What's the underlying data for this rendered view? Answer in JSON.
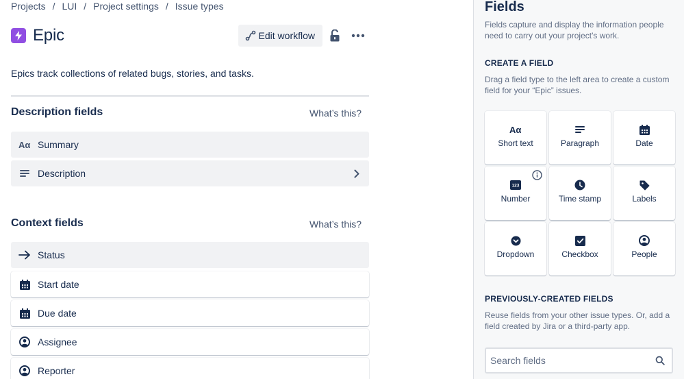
{
  "breadcrumb": [
    "Projects",
    "LUI",
    "Project settings",
    "Issue types"
  ],
  "breadcrumb_separator": "/",
  "issue_type": {
    "title": "Epic",
    "icon": "lightning-icon",
    "color": "#904ee2",
    "description": "Epics track collections of related bugs, stories, and tasks."
  },
  "actions": {
    "edit_workflow_label": "Edit workflow",
    "lock_icon": "unlock-icon",
    "more_icon": "more-icon"
  },
  "description_fields": {
    "title": "Description fields",
    "help": "What’s this?",
    "items": [
      {
        "label": "Summary",
        "icon": "short-text-icon"
      },
      {
        "label": "Description",
        "icon": "paragraph-icon"
      }
    ]
  },
  "context_fields": {
    "title": "Context fields",
    "help": "What’s this?",
    "items": [
      {
        "label": "Status",
        "icon": "arrow-right-icon"
      },
      {
        "label": "Start date",
        "icon": "calendar-icon"
      },
      {
        "label": "Due date",
        "icon": "calendar-icon"
      },
      {
        "label": "Assignee",
        "icon": "person-icon"
      },
      {
        "label": "Reporter",
        "icon": "person-icon"
      }
    ]
  },
  "panel": {
    "title": "Fields",
    "description": "Fields capture and display the information people need to carry out your project's work.",
    "create": {
      "heading": "CREATE A FIELD",
      "description": "Drag a field type to the left area to create a custom field for your “Epic” issues.",
      "types": [
        {
          "label": "Short text",
          "icon": "short-text-icon"
        },
        {
          "label": "Paragraph",
          "icon": "paragraph-icon"
        },
        {
          "label": "Date",
          "icon": "calendar-icon"
        },
        {
          "label": "Number",
          "icon": "number-icon",
          "info": true
        },
        {
          "label": "Time stamp",
          "icon": "clock-icon"
        },
        {
          "label": "Labels",
          "icon": "tag-icon"
        },
        {
          "label": "Dropdown",
          "icon": "dropdown-icon"
        },
        {
          "label": "Checkbox",
          "icon": "checkbox-icon"
        },
        {
          "label": "People",
          "icon": "person-icon"
        }
      ]
    },
    "previous": {
      "heading": "PREVIOUSLY-CREATED FIELDS",
      "description": "Reuse fields from your other issue types. Or, add a field created by Jira or a third-party app."
    },
    "search": {
      "placeholder": "Search fields",
      "icon": "search-icon"
    }
  }
}
